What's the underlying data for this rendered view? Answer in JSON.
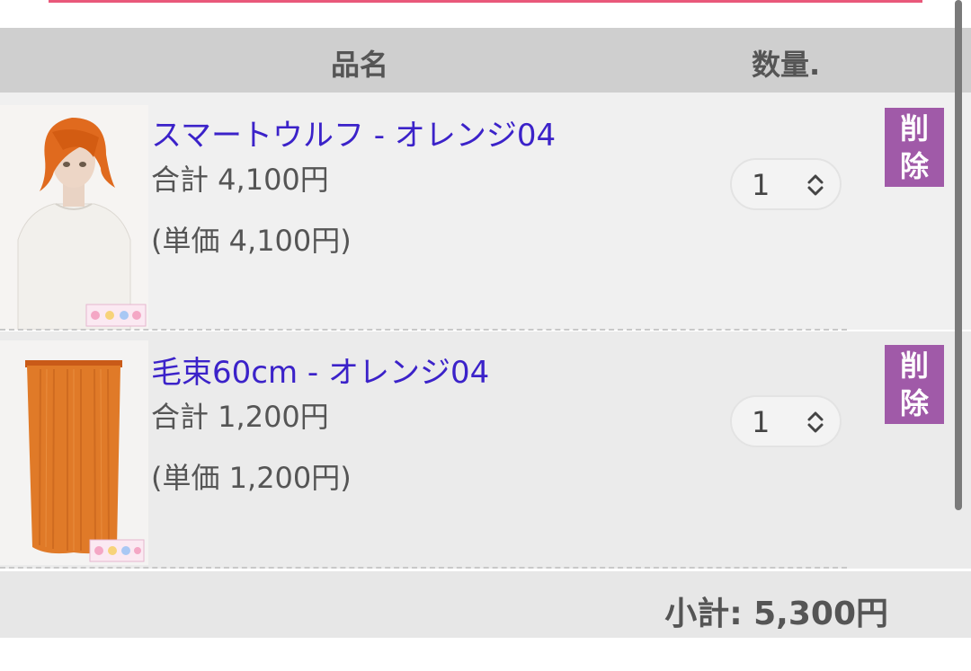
{
  "header": {
    "col_name": "品名",
    "col_qty": "数量."
  },
  "items": [
    {
      "name": "スマートウルフ - オレンジ04",
      "total": "合計 4,100円",
      "unit_price": "(単価 4,100円)",
      "quantity": "1",
      "delete_label": [
        "削",
        "除"
      ],
      "thumb_icon": "orange-wig-mannequin-icon"
    },
    {
      "name": "毛束60cm - オレンジ04",
      "total": "合計 1,200円",
      "unit_price": "(単価 1,200円)",
      "quantity": "1",
      "delete_label": [
        "削",
        "除"
      ],
      "thumb_icon": "orange-hair-extension-icon"
    }
  ],
  "footer": {
    "subtotal": "小計: 5,300円"
  },
  "colors": {
    "link": "#3b22c9",
    "delete_button": "#a05aa8",
    "header_bg": "#cfcfcf",
    "hair_orange": "#e06a1e"
  }
}
